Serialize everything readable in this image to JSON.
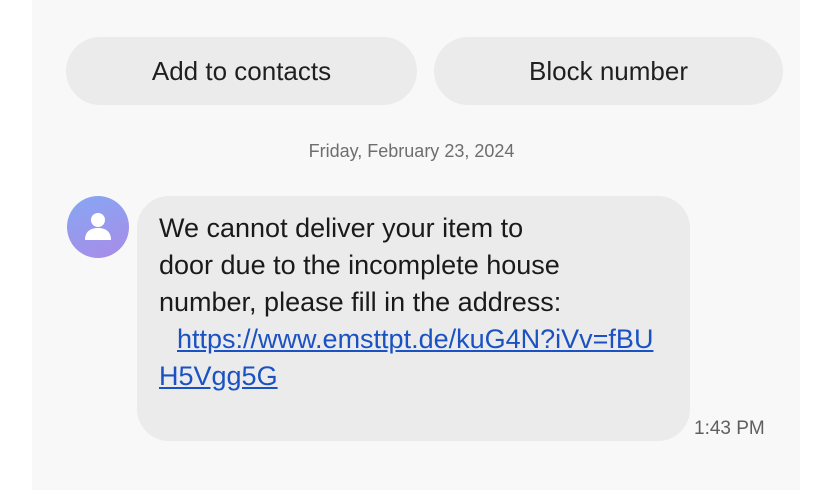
{
  "actions": {
    "add_to_contacts": "Add to contacts",
    "block_number": "Block number"
  },
  "conversation": {
    "date": "Friday, February 23, 2024",
    "message": {
      "text": "We cannot deliver your item to\ndoor due to the incomplete house\nnumber, please fill in the address:\n",
      "link": "https://www.emsttpt.de/kuG4N?iVv=fBUH5Vgg5G",
      "time": "1:43 PM"
    }
  },
  "colors": {
    "link": "#1a52c4",
    "bubble": "#ebebeb",
    "avatar_gradient": [
      "#86a7f2",
      "#a98be8"
    ]
  },
  "icons": {
    "avatar": "person-icon"
  }
}
